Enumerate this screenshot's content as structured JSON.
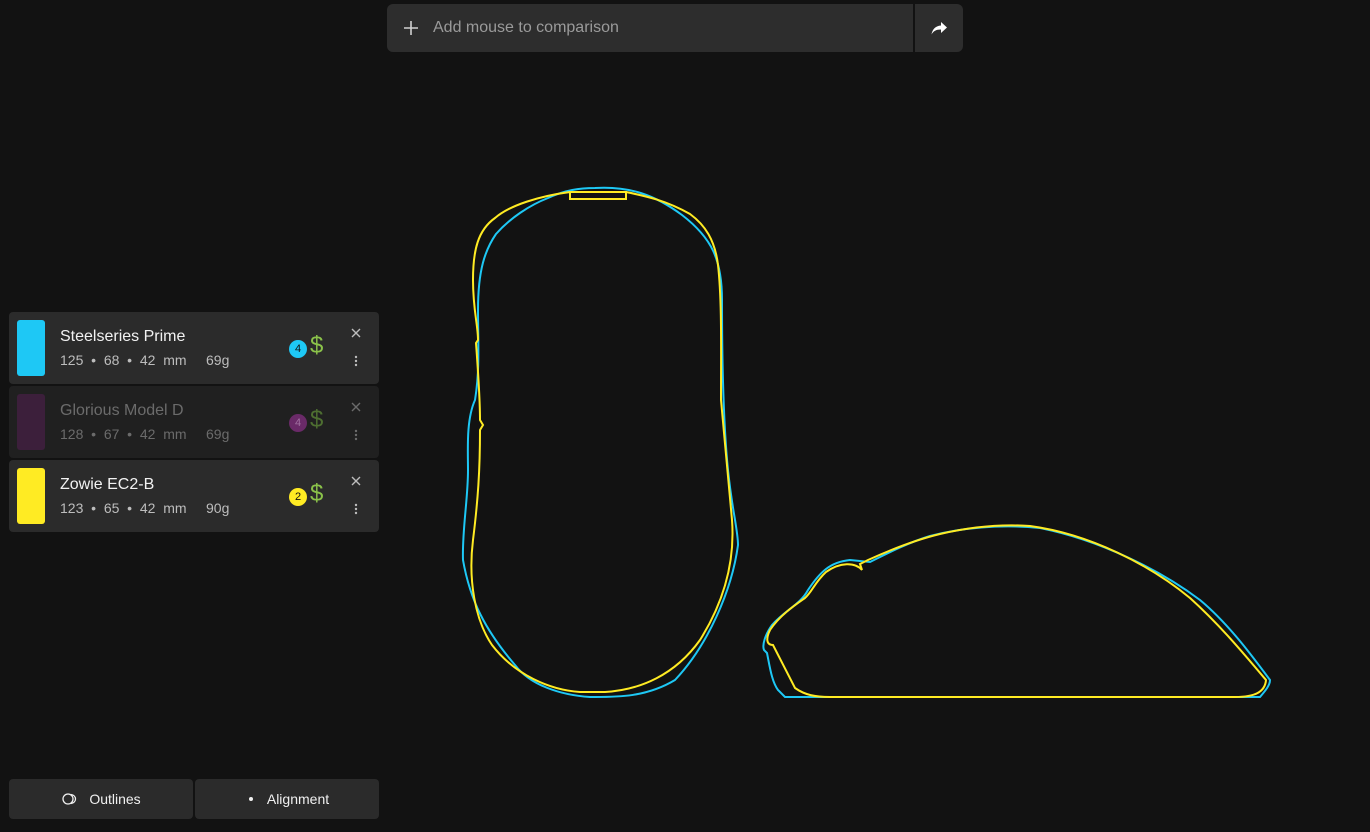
{
  "search": {
    "placeholder": "Add mouse to comparison"
  },
  "mice": [
    {
      "name": "Steelseries Prime",
      "length": "125",
      "width": "68",
      "height": "42",
      "unit": "mm",
      "weight": "69g",
      "badge": "4",
      "price": "$",
      "color": "#1ec8f5",
      "active": true
    },
    {
      "name": "Glorious Model D",
      "length": "128",
      "width": "67",
      "height": "42",
      "unit": "mm",
      "weight": "69g",
      "badge": "4",
      "price": "$",
      "color": "#3c1f3b",
      "active": false
    },
    {
      "name": "Zowie EC2-B",
      "length": "123",
      "width": "65",
      "height": "42",
      "unit": "mm",
      "weight": "90g",
      "badge": "2",
      "price": "$",
      "color": "#ffeb23",
      "active": true
    }
  ],
  "footer": {
    "outlines_label": "Outlines",
    "alignment_label": "Alignment"
  },
  "colors": {
    "background": "#121212",
    "panel": "#2b2b2b",
    "price": "#8bc34a",
    "outline_blue": "#1ec8f5",
    "outline_yellow": "#ffeb23"
  }
}
